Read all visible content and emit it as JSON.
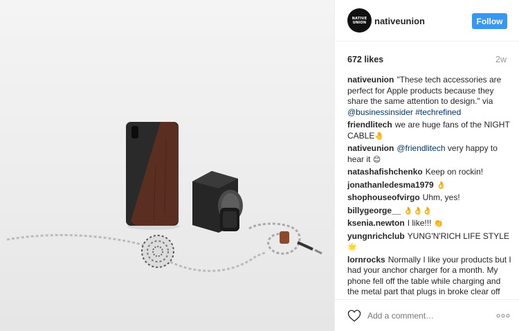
{
  "post": {
    "username": "nativeunion",
    "avatar_text": "NATIVE UNION",
    "follow_label": "Follow",
    "likes": "672 likes",
    "age": "2w"
  },
  "comments": [
    {
      "user": "nativeunion",
      "text": "\"These tech accessories are perfect for Apple products because they share the same attention to design.\" via ",
      "tag": "@businessinsider #techrefined",
      "after": ""
    },
    {
      "user": "friendlitech",
      "text": "we are huge fans of the NIGHT CABLE",
      "emoji": "🤚",
      "after": ""
    },
    {
      "user": "nativeunion",
      "text": "",
      "tag": "@friendlitech",
      "after": " very happy to hear it ",
      "emoji": "😊"
    },
    {
      "user": "natashafishchenko",
      "text": "Keep on rockin!"
    },
    {
      "user": "jonathanledesma1979",
      "text": "",
      "emoji": "👌"
    },
    {
      "user": "shophouseofvirgo",
      "text": "Uhm, yes!"
    },
    {
      "user": "billygeorge__",
      "text": "",
      "emoji": "👌👌👌"
    },
    {
      "user": "ksenia.newton",
      "text": "I like!!!",
      "emoji": "👏"
    },
    {
      "user": "yungnrichclub",
      "text": "YUNG'N'RICH LIFE STYLE",
      "emoji": "🌟"
    },
    {
      "user": "lornrocks",
      "text": "Normally I like your products but I had your anchor charger for a month. My phone fell off the table while charging and the metal part that plugs in broke clear off"
    }
  ],
  "footer": {
    "add_comment_placeholder": "Add a comment…"
  },
  "icons": {
    "heart": "heart-icon",
    "more": "more-options-icon"
  },
  "colors": {
    "follow_button": "#3897f0",
    "link": "#003569",
    "meta_text": "#999999"
  }
}
